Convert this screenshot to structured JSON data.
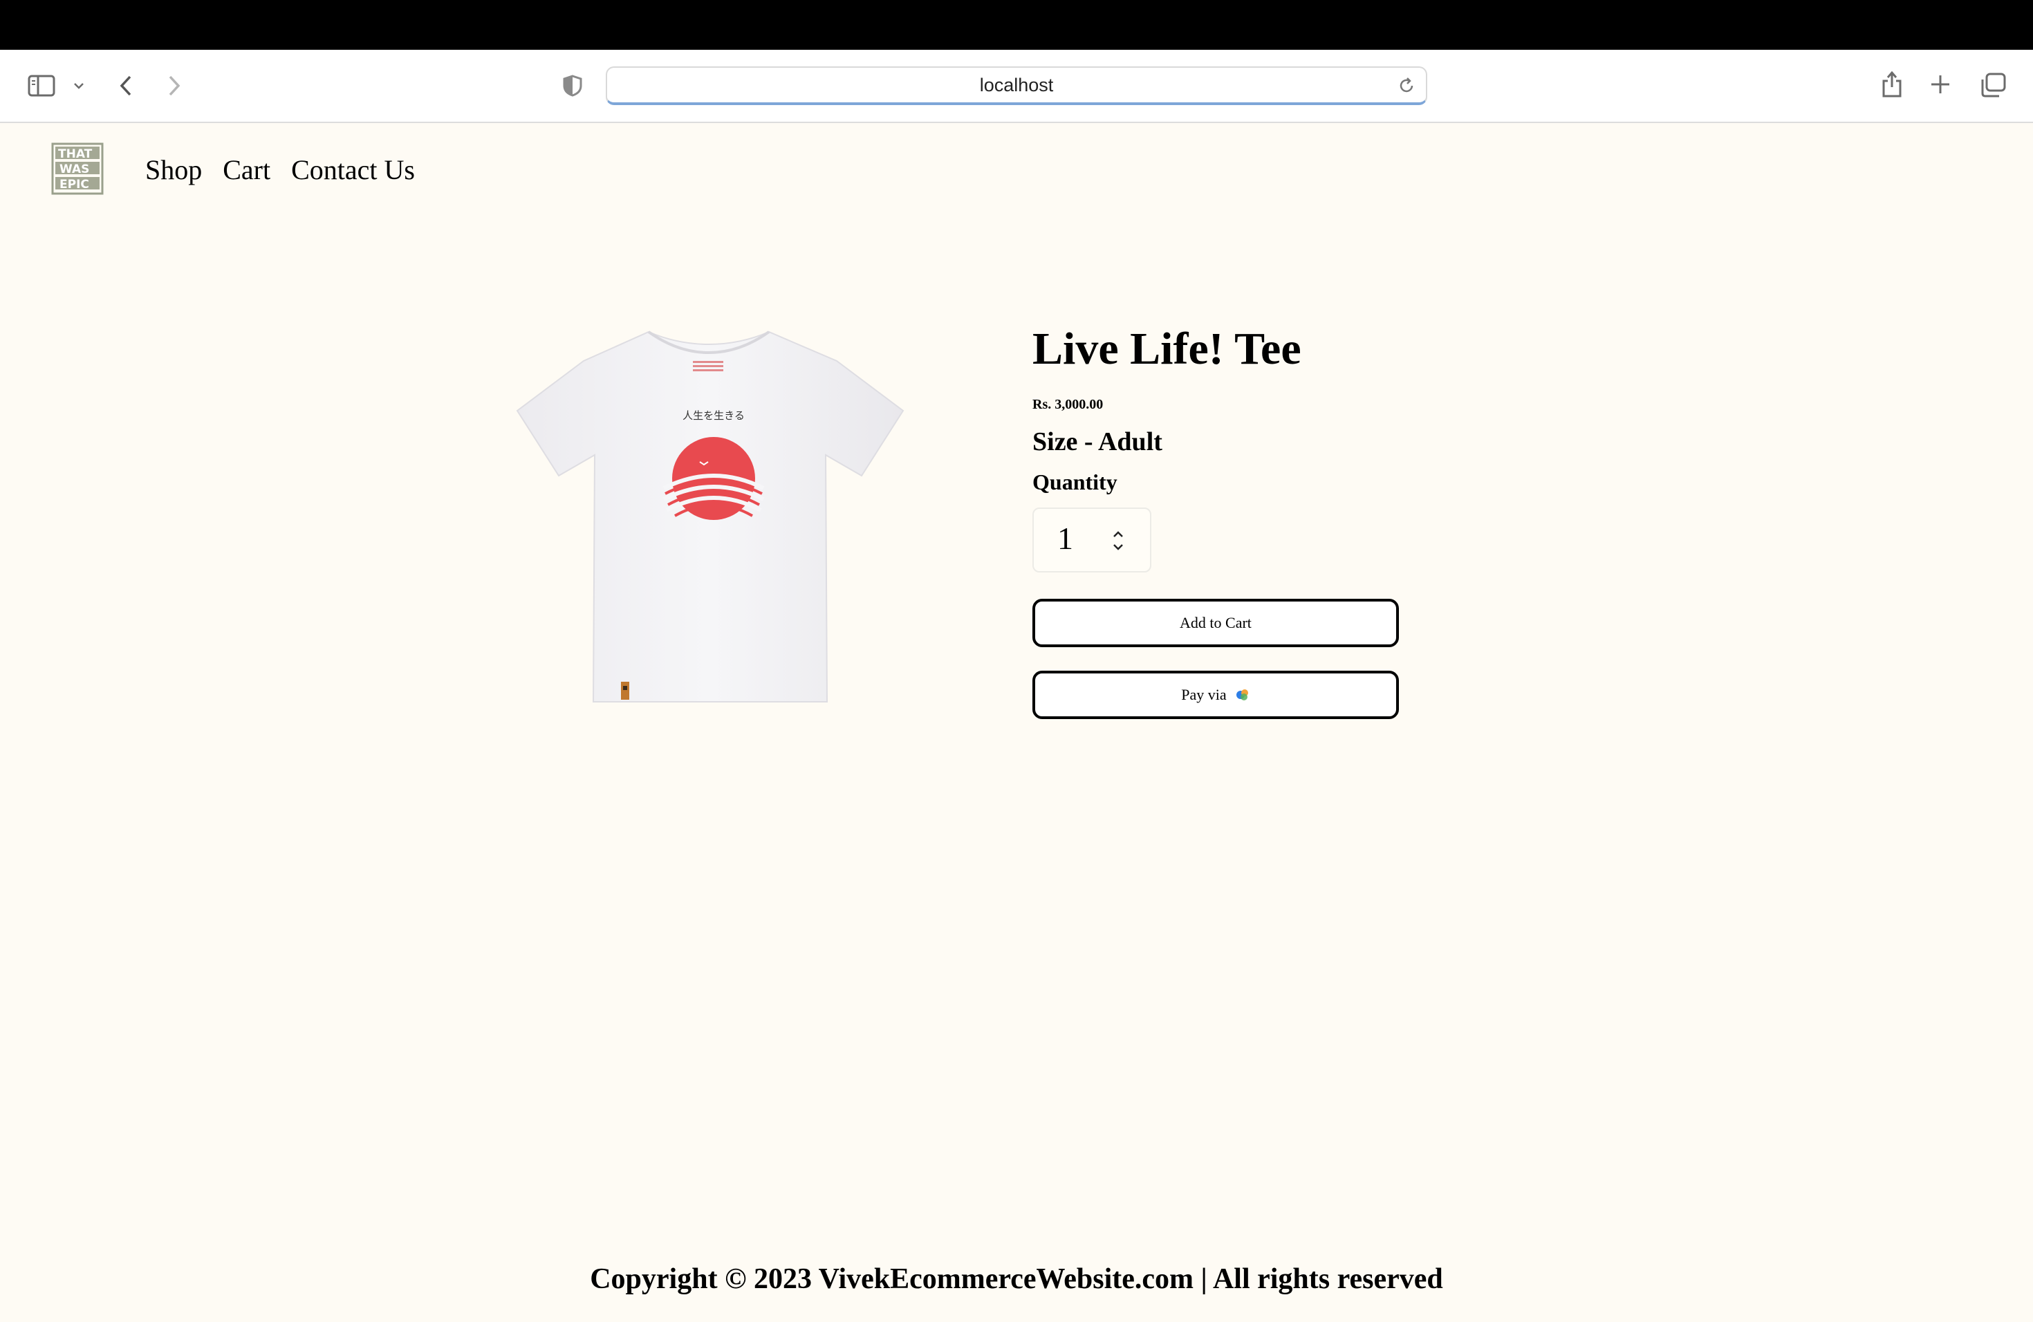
{
  "browser": {
    "url": "localhost"
  },
  "site": {
    "logo_text": "THAT WAS EPIC",
    "nav": [
      "Shop",
      "Cart",
      "Contact Us"
    ]
  },
  "product": {
    "image_caption": "人生を生きる",
    "title": "Live Life! Tee",
    "price": "Rs. 3,000.00",
    "size": "Size - Adult",
    "quantity_label": "Quantity",
    "quantity_value": "1",
    "add_to_cart": "Add to Cart",
    "pay_via": "Pay via"
  },
  "footer": {
    "copyright": "Copyright © 2023 VivekEcommerceWebsite.com | All rights reserved"
  },
  "colors": {
    "background": "#fefbf4",
    "accent_red": "#e84a4f"
  }
}
